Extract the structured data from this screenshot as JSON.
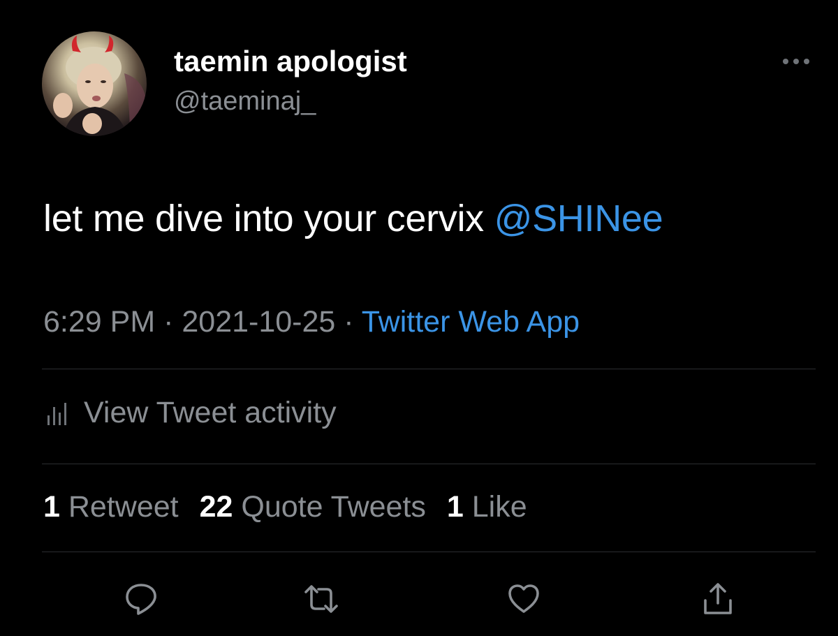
{
  "author": {
    "display_name": "taemin apologist",
    "handle": "@taeminaj_",
    "avatar_icon": "profile-photo"
  },
  "more_icon": "more-horizontal-icon",
  "tweet": {
    "text": "let me dive into your cervix ",
    "mention": "@SHINee"
  },
  "meta": {
    "time": "6:29 PM",
    "separator": " · ",
    "date": "2021-10-25",
    "source": "Twitter Web App"
  },
  "activity": {
    "label": "View Tweet activity",
    "icon": "bar-chart-icon"
  },
  "counts": {
    "retweets": {
      "num": "1",
      "label": "Retweet"
    },
    "quotes": {
      "num": "22",
      "label": "Quote Tweets"
    },
    "likes": {
      "num": "1",
      "label": "Like"
    }
  },
  "actions": [
    {
      "name": "reply",
      "icon": "reply-icon"
    },
    {
      "name": "retweet",
      "icon": "retweet-icon"
    },
    {
      "name": "like",
      "icon": "heart-icon"
    },
    {
      "name": "share",
      "icon": "share-icon"
    }
  ],
  "colors": {
    "background": "#000000",
    "link": "#3b94e6",
    "secondary_text": "#8b8f94",
    "primary_text": "#ffffff",
    "divider": "#2c2e31"
  }
}
